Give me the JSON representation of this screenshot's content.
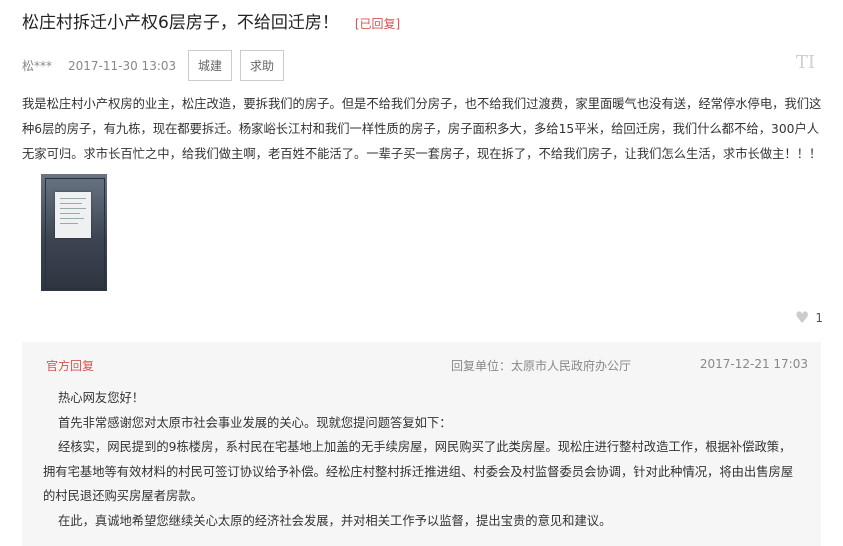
{
  "post": {
    "title": "松庄村拆迁小产权6层房子，不给回迁房！",
    "status": "[已回复]",
    "author": "松***",
    "date": "2017-11-30 13:03",
    "tags": [
      "城建",
      "求助"
    ],
    "font_toggle": "TI",
    "content": "我是松庄村小产权房的业主，松庄改造，要拆我们的房子。但是不给我们分房子，也不给我们过渡费，家里面暖气也没有送，经常停水停电，我们这种6层的房子，有九栋，现在都要拆迁。杨家峪长江村和我们一样性质的房子，房子面积多大，多给15平米，给回迁房，我们什么都不给，300户人无家可归。求市长百忙之中，给我们做主啊，老百姓不能活了。一辈子买一套房子，现在拆了，不给我们房子，让我们怎么生活，求市长做主！！！",
    "like_count": "1"
  },
  "reply": {
    "label": "官方回复",
    "unit": "回复单位：太原市人民政府办公厅",
    "date": "2017-12-21 17:03",
    "paragraphs": [
      "热心网友您好！",
      "首先非常感谢您对太原市社会事业发展的关心。现就您提问题答复如下：",
      "经核实，网民提到的9栋楼房，系村民在宅基地上加盖的无手续房屋，网民购买了此类房屋。现松庄进行整村改造工作，根据补偿政策，拥有宅基地等有效材料的村民可签订协议给予补偿。经松庄村整村拆迁推进组、村委会及村监督委员会协调，针对此种情况，将由出售房屋的村民退还购买房屋者房款。",
      "在此，真诚地希望您继续关心太原的经济社会发展，并对相关工作予以监督，提出宝贵的意见和建议。"
    ]
  },
  "colors": {
    "accent": "#d9534f",
    "reply_bg": "#f6f6f6"
  },
  "icons": {
    "like": "heart-icon"
  }
}
